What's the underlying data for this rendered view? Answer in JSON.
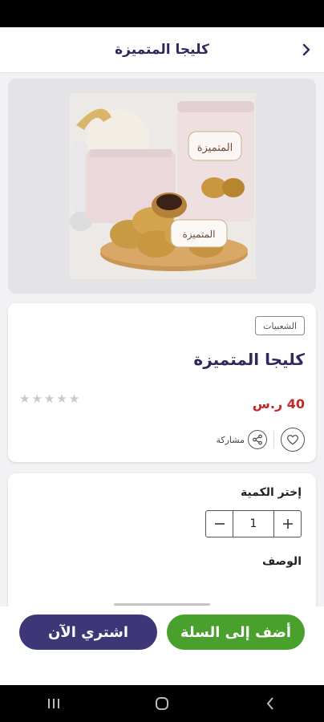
{
  "header": {
    "title": "كليجا المتميزة",
    "back_icon": "chevron-right-icon"
  },
  "product": {
    "category": "الشعبيات",
    "name": "كليجا المتميزة",
    "price": "40 ر.س",
    "rating": 0,
    "rating_max": 5,
    "share_label": "مشاركة",
    "package_label": "المتميزة"
  },
  "purchase": {
    "quantity_label": "إختر الكمية",
    "quantity_value": "1",
    "description_label": "الوصف"
  },
  "buttons": {
    "add_to_cart": "أضف إلى السلة",
    "buy_now": "اشتري الآن"
  },
  "colors": {
    "primary": "#3d3778",
    "accent_green": "#4aa02c",
    "price_red": "#c62828"
  }
}
